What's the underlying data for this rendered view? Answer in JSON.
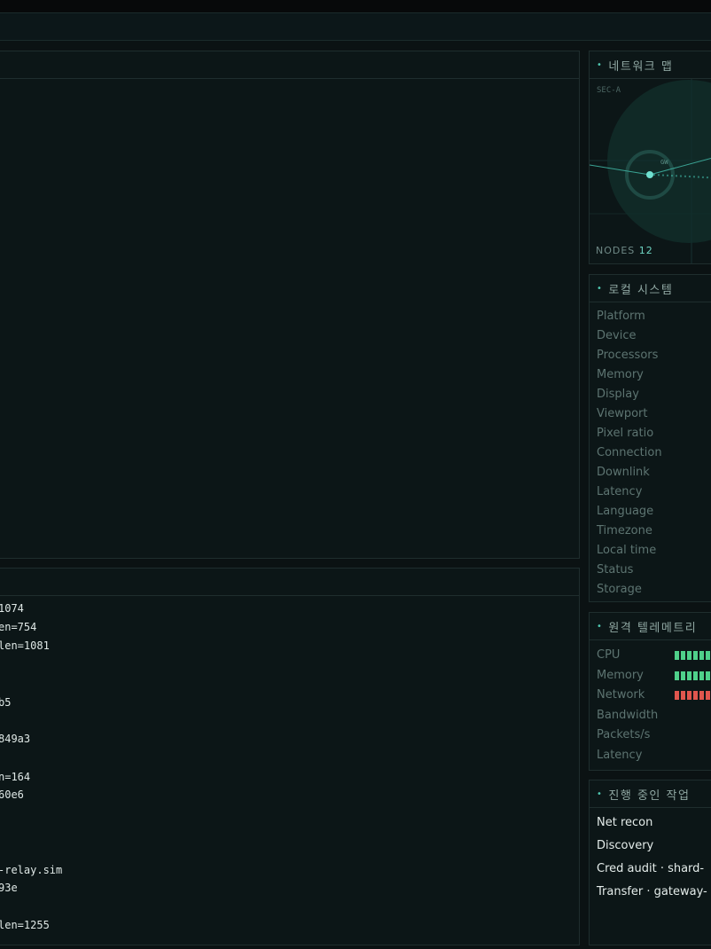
{
  "panels": {
    "map_title": "네트워크 맵",
    "system_title": "로컬 시스템",
    "telemetry_title": "원격 텔레메트리",
    "tasks_title": "진행 중인 작업"
  },
  "map": {
    "sector": "SEC-A",
    "node_label": "GW",
    "nodes_label": "NODES",
    "nodes_count": "12"
  },
  "system_items": [
    "Platform",
    "Device",
    "Processors",
    "Memory",
    "Display",
    "Viewport",
    "Pixel ratio",
    "Connection",
    "Downlink",
    "Latency",
    "Language",
    "Timezone",
    "Local time",
    "Status",
    "Storage"
  ],
  "telemetry": [
    {
      "label": "CPU",
      "bar_color": "#4fd08a",
      "level": 6
    },
    {
      "label": "Memory",
      "bar_color": "#4fd08a",
      "level": 6
    },
    {
      "label": "Network",
      "bar_color": "#e0564e",
      "level": 6
    },
    {
      "label": "Bandwidth"
    },
    {
      "label": "Packets/s"
    },
    {
      "label": "Latency"
    }
  ],
  "tasks": [
    "Net recon",
    "Discovery",
    "Cred audit · shard-",
    "Transfer · gateway-"
  ],
  "log_lines": [
    "1074",
    "en=754",
    " len=1081",
    "b5",
    "849a3",
    "n=164",
    "60e6",
    "-relay.sim",
    "93e",
    "len=1255"
  ],
  "colors": {
    "accent": "#4fc7b0",
    "ok": "#4fd08a",
    "alert": "#e0564e"
  }
}
